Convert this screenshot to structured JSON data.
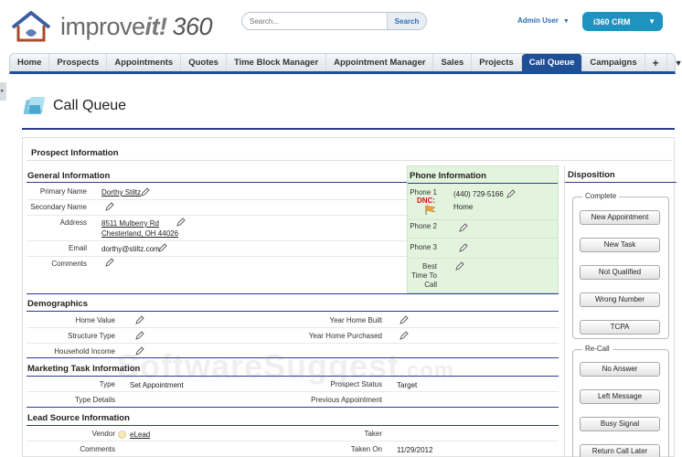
{
  "header": {
    "logo_text_a": "improve",
    "logo_text_b": "it!",
    "logo_text_c": "360",
    "search_placeholder": "Search...",
    "search_button": "Search",
    "user_menu": "Admin User",
    "app_switch": "i360 CRM"
  },
  "nav": {
    "tabs": [
      {
        "label": "Home"
      },
      {
        "label": "Prospects"
      },
      {
        "label": "Appointments"
      },
      {
        "label": "Quotes"
      },
      {
        "label": "Time Block Manager"
      },
      {
        "label": "Appointment Manager"
      },
      {
        "label": "Sales"
      },
      {
        "label": "Projects"
      },
      {
        "label": "Call Queue",
        "active": true
      },
      {
        "label": "Campaigns"
      }
    ],
    "plus_icon": "+",
    "more_icon": "▼"
  },
  "page": {
    "title": "Call Queue"
  },
  "prospect": {
    "section_title": "Prospect Information",
    "general": {
      "title": "General Information",
      "primary_name_label": "Primary Name",
      "primary_name_value": "Dorthy Stiltz",
      "secondary_name_label": "Secondary Name",
      "address_label": "Address",
      "address_line1": "8511 Mulberry Rd",
      "address_line2": "Chesterland, OH 44026",
      "email_label": "Email",
      "email_value": "dorthy@stiltz.com",
      "comments_label": "Comments"
    },
    "phone": {
      "title": "Phone Information",
      "phone1_label": "Phone 1",
      "dnc_label": "DNC:",
      "phone1_value": "(440) 729-5166",
      "phone1_type": "Home",
      "phone2_label": "Phone 2",
      "phone3_label": "Phone 3",
      "best_time_label_1": "Best",
      "best_time_label_2": "Time To",
      "best_time_label_3": "Call"
    },
    "demographics": {
      "title": "Demographics",
      "home_value_label": "Home Value",
      "structure_type_label": "Structure Type",
      "household_income_label": "Household Income",
      "year_built_label": "Year Home Built",
      "year_purchased_label": "Year Home Purchased"
    },
    "marketing": {
      "title": "Marketing Task Information",
      "type_label": "Type",
      "type_value": "Set Appointment",
      "type_details_label": "Type Details",
      "prospect_status_label": "Prospect Status",
      "prospect_status_value": "Target",
      "previous_appt_label": "Previous Appointment"
    },
    "lead_source": {
      "title": "Lead Source Information",
      "vendor_label": "Vendor",
      "vendor_value": "eLead",
      "comments_label": "Comments",
      "taker_label": "Taker",
      "taken_on_label": "Taken On",
      "taken_on_value": "11/29/2012"
    }
  },
  "disposition": {
    "title": "Disposition",
    "complete_group": "Complete",
    "complete_buttons": [
      "New Appointment",
      "New Task",
      "Not Qualified",
      "Wrong Number",
      "TCPA"
    ],
    "recall_group": "Re-Call",
    "recall_buttons": [
      "No Answer",
      "Left Message",
      "Busy Signal",
      "Return Call Later"
    ]
  },
  "watermark": {
    "main": "SoftwareSuggest",
    "suffix": ".com"
  },
  "colors": {
    "accent": "#1f4f96",
    "phone_bg": "#e3f4de",
    "app_switch": "#1e93bf",
    "link": "#2d6fb4"
  }
}
